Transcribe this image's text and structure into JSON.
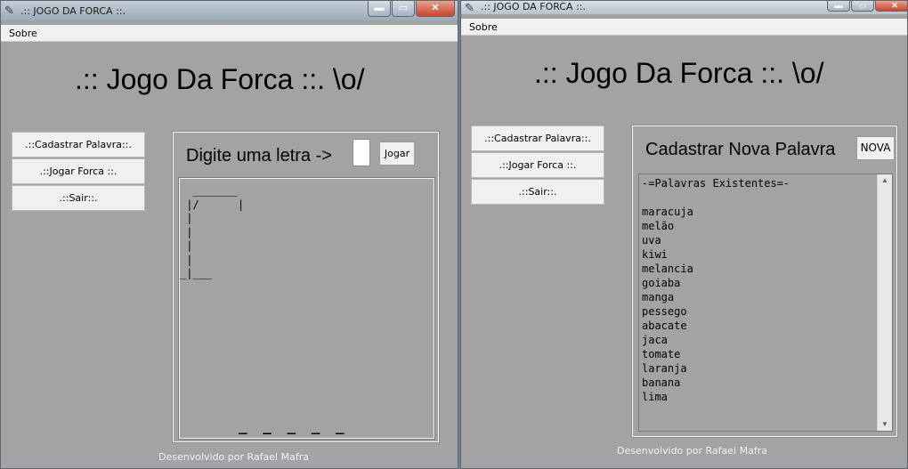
{
  "left_window": {
    "title": ".:: JOGO DA FORCA ::.",
    "icon": "feather-icon",
    "controls": {
      "minimize": "▬",
      "maximize": "▭",
      "close": "✕"
    },
    "menu": [
      "Sobre"
    ],
    "heading": ".:: Jogo Da Forca ::. \\o/",
    "side_buttons": [
      ".::Cadastrar Palavra::.",
      ".::Jogar Forca ::.",
      ".::Sair::."
    ],
    "game": {
      "prompt": "Digite uma letra ->",
      "letter_value": "",
      "play_button": "Jogar",
      "gallows_art": "  _______\n |/      |\n |\n |\n |\n |\n_|___",
      "word_slots": "_ _ _ _ _"
    },
    "footer": "Desenvolvido por Rafael Mafra"
  },
  "right_window": {
    "title": ".:: JOGO DA FORCA ::.",
    "icon": "feather-icon",
    "controls": {
      "minimize": "▬",
      "maximize": "▭",
      "close": "✕"
    },
    "menu": [
      "Sobre"
    ],
    "heading": ".:: Jogo Da Forca ::. \\o/",
    "side_buttons": [
      ".::Cadastrar Palavra::.",
      ".::Jogar Forca ::.",
      ".::Sair::."
    ],
    "register": {
      "title": "Cadastrar Nova Palavra",
      "new_button": "NOVA",
      "words": [
        "-=Palavras Existentes=-",
        "",
        "maracuja",
        "melão",
        "uva",
        "kiwi",
        "melancia",
        "goiaba",
        "manga",
        "pessego",
        "abacate",
        "jaca",
        "tomate",
        "laranja",
        "banana",
        "lima"
      ]
    },
    "footer": "Desenvolvido por Rafael Mafra"
  }
}
